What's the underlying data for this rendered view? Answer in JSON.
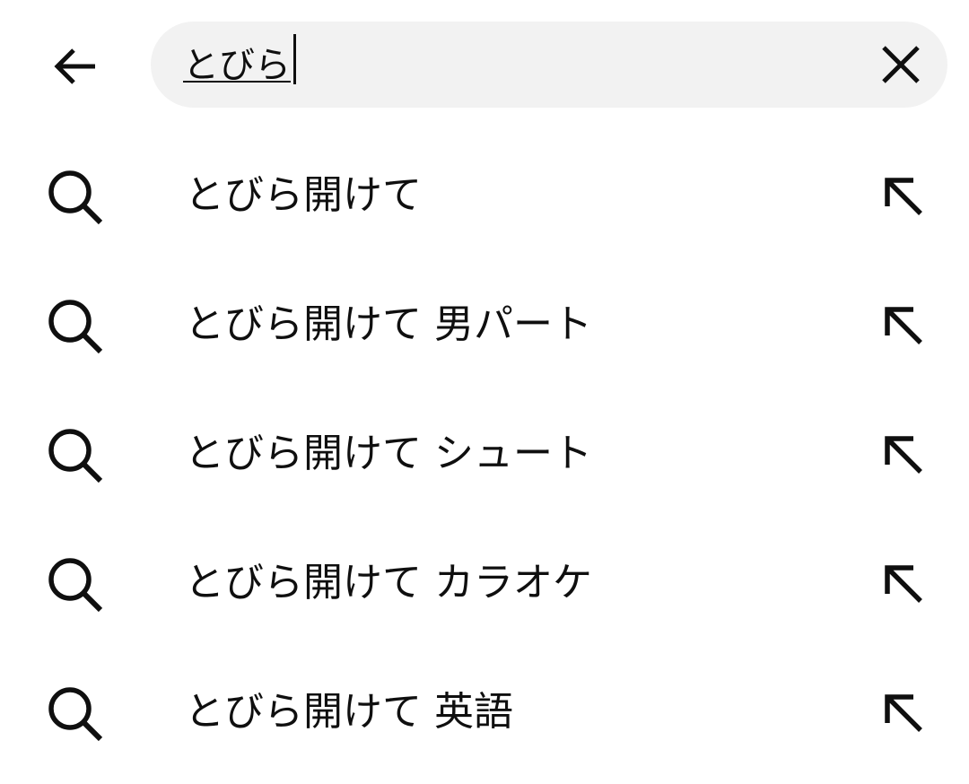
{
  "search": {
    "query": "とびら"
  },
  "icons": {
    "back": "arrow-left-icon",
    "clear": "close-icon",
    "suggestion": "search-icon",
    "fill": "arrow-up-left-icon"
  },
  "suggestions": [
    {
      "text": "とびら開けて"
    },
    {
      "text": "とびら開けて 男パート"
    },
    {
      "text": "とびら開けて シュート"
    },
    {
      "text": "とびら開けて カラオケ"
    },
    {
      "text": "とびら開けて 英語"
    }
  ]
}
